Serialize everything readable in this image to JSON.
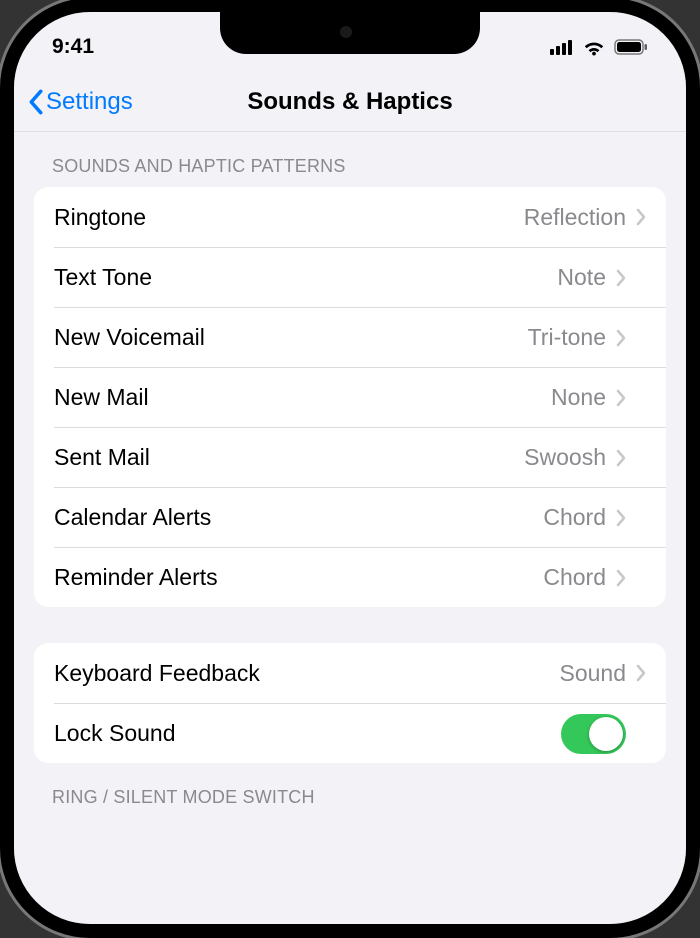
{
  "status": {
    "time": "9:41"
  },
  "nav": {
    "back": "Settings",
    "title": "Sounds & Haptics"
  },
  "section1": {
    "header": "SOUNDS AND HAPTIC PATTERNS",
    "rows": [
      {
        "label": "Ringtone",
        "value": "Reflection"
      },
      {
        "label": "Text Tone",
        "value": "Note"
      },
      {
        "label": "New Voicemail",
        "value": "Tri-tone"
      },
      {
        "label": "New Mail",
        "value": "None"
      },
      {
        "label": "Sent Mail",
        "value": "Swoosh"
      },
      {
        "label": "Calendar Alerts",
        "value": "Chord"
      },
      {
        "label": "Reminder Alerts",
        "value": "Chord"
      }
    ]
  },
  "section2": {
    "rows": [
      {
        "label": "Keyboard Feedback",
        "value": "Sound"
      },
      {
        "label": "Lock Sound",
        "toggle": true
      }
    ]
  },
  "section3": {
    "header": "RING / SILENT MODE SWITCH"
  }
}
